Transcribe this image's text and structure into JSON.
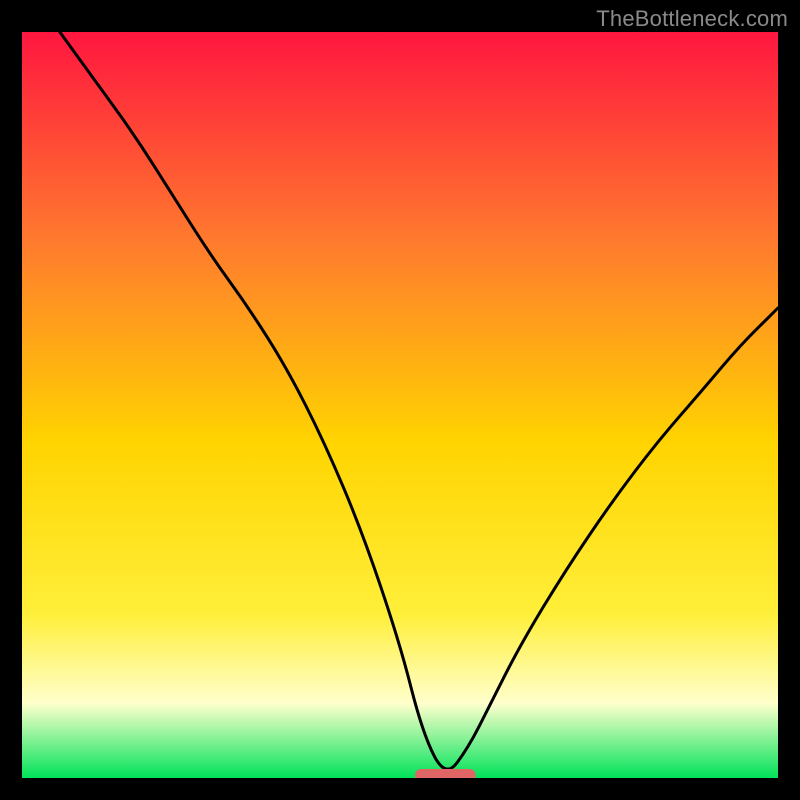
{
  "watermark": "TheBottleneck.com",
  "colors": {
    "bg": "#000000",
    "watermark": "#8a8a8a",
    "curve": "#000000",
    "marker": "#e06666",
    "grad_top": "#ff163f",
    "grad_mid_upper": "#ff7a2e",
    "grad_mid": "#ffd400",
    "grad_mid_lower": "#ffef3a",
    "grad_pale": "#ffffcc",
    "grad_green": "#00e35a"
  },
  "chart_data": {
    "type": "line",
    "title": "",
    "xlabel": "",
    "ylabel": "",
    "x_range": [
      0,
      100
    ],
    "y_range": [
      0,
      100
    ],
    "grid": false,
    "legend": false,
    "notes": "V-shaped bottleneck curve on vertical rainbow gradient (red top → green bottom). Minimum around x≈56, y≈0. Left branch steeper and starts at top-left; right branch rises to ~y≈63 at x=100.",
    "series": [
      {
        "name": "bottleneck_curve",
        "x": [
          5,
          10,
          15,
          20,
          25,
          30,
          35,
          40,
          45,
          50,
          53,
          56,
          59,
          62,
          66,
          72,
          78,
          84,
          90,
          95,
          100
        ],
        "y": [
          100,
          93,
          86,
          78,
          70,
          63,
          55,
          45,
          33,
          18,
          6,
          0,
          4,
          10,
          18,
          28,
          37,
          45,
          52,
          58,
          63
        ]
      }
    ],
    "marker": {
      "x": 56,
      "y": 0,
      "width_x": 8
    }
  }
}
